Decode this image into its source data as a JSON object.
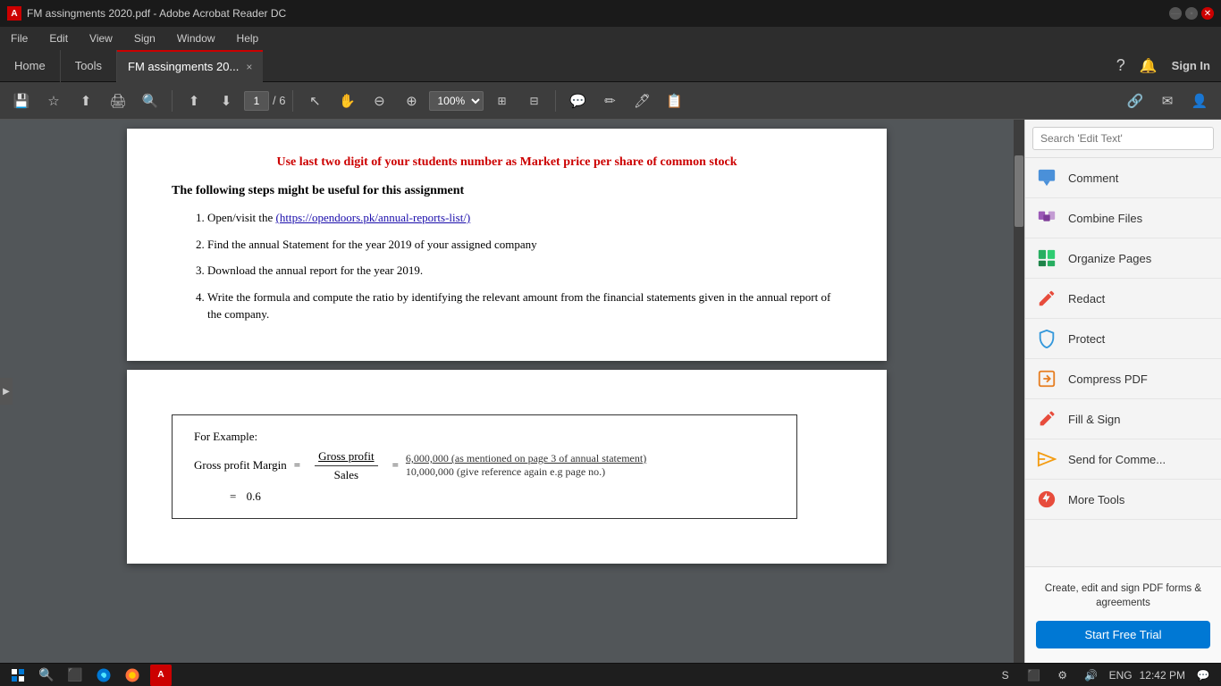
{
  "titleBar": {
    "title": "FM assingments 2020.pdf - Adobe Acrobat Reader DC",
    "appIcon": "A"
  },
  "menuBar": {
    "items": [
      "File",
      "Edit",
      "View",
      "Sign",
      "Window",
      "Help"
    ]
  },
  "tabs": {
    "home": "Home",
    "tools": "Tools",
    "active": "FM assingments 20...",
    "closeBtn": "×"
  },
  "tabBarRight": {
    "signIn": "Sign In"
  },
  "toolbar": {
    "pageInput": "1",
    "pageTotal": "/ 6",
    "zoom": "100%"
  },
  "pdfPage1": {
    "redText": "Use last two digit of your students number as Market price per share of common stock",
    "heading": "The following steps might be useful for this assignment",
    "items": [
      {
        "number": "1.",
        "text": "Open/visit the ",
        "link": "(https://opendoors.pk/annual-reports-list/)"
      },
      {
        "number": "2.",
        "text": "Find the annual Statement for the year 2019 of your assigned company"
      },
      {
        "number": "3.",
        "text": "Download the annual report for the year 2019."
      },
      {
        "number": "4.",
        "text": "Write the formula and compute the ratio by identifying the relevant amount from the financial statements given in the annual report of the company."
      }
    ]
  },
  "pdfPage2": {
    "forExample": "For Example:",
    "formulaLabel": "Gross profit Margin",
    "equals1": "=",
    "numerator": "Gross profit",
    "denominator": "Sales",
    "equals2": "=",
    "value1": "6,000,000 (as mentioned on page 3 of annual statement)",
    "value2": "10,000,000 (give reference again e.g page no.)",
    "resultEquals": "=",
    "result": "0.6"
  },
  "rightPanel": {
    "searchPlaceholder": "Search 'Edit Text'",
    "items": [
      {
        "label": "Comment",
        "iconColor": "#4a90d9",
        "icon": "💬"
      },
      {
        "label": "Combine Files",
        "iconColor": "#9b59b6",
        "icon": "⬜"
      },
      {
        "label": "Organize Pages",
        "iconColor": "#27ae60",
        "icon": "⬛"
      },
      {
        "label": "Redact",
        "iconColor": "#e74c3c",
        "icon": "✏️"
      },
      {
        "label": "Protect",
        "iconColor": "#3498db",
        "icon": "🛡"
      },
      {
        "label": "Compress PDF",
        "iconColor": "#e67e22",
        "icon": "⬇"
      },
      {
        "label": "Fill & Sign",
        "iconColor": "#e74c3c",
        "icon": "✒"
      },
      {
        "label": "Send for Comme...",
        "iconColor": "#f39c12",
        "icon": "📤"
      },
      {
        "label": "More Tools",
        "iconColor": "#e74c3c",
        "icon": "🔧"
      }
    ],
    "promoText": "Create, edit and sign PDF forms & agreements",
    "trialBtn": "Start Free Trial"
  },
  "statusBar": {
    "time": "12:42 PM",
    "language": "ENG"
  }
}
